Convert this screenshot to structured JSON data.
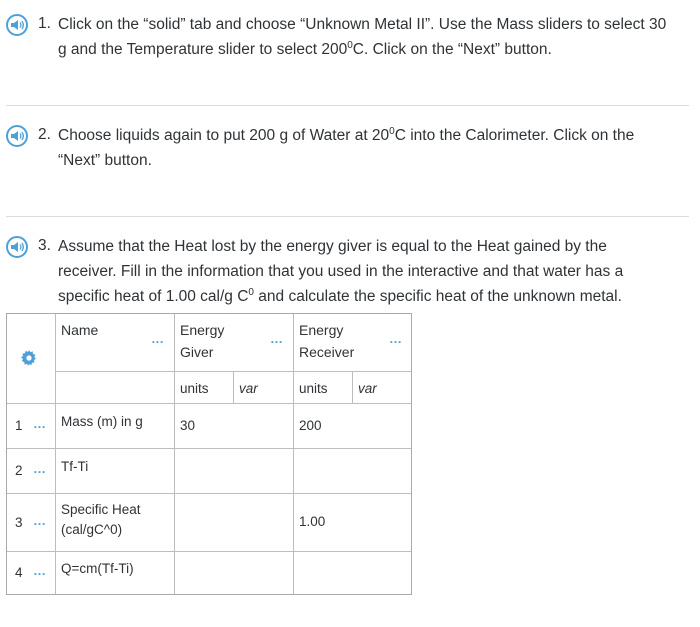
{
  "questions": [
    {
      "number": "1.",
      "lines": [
        "Click on the “solid” tab and choose “Unknown Metal II”.  Use the Mass sliders to select 30",
        [
          "g and the Temperature slider to select 200",
          "0",
          "C.  Click on the “Next” button."
        ]
      ]
    },
    {
      "number": "2.",
      "lines": [
        [
          "Choose liquids again to put 200 g of Water at 20",
          "0",
          "C into the Calorimeter. Click on the"
        ],
        "“Next” button."
      ]
    },
    {
      "number": "3.",
      "lines": [
        "Assume that the Heat lost by the energy giver is equal to the Heat gained by the",
        "receiver. Fill in the information that you used in the interactive and that water has a",
        [
          "specific heat of 1.00 cal/g C",
          "0",
          " and calculate the specific heat of the unknown metal."
        ]
      ]
    }
  ],
  "table": {
    "headers": {
      "name": "Name",
      "giver": [
        "Energy",
        "Giver"
      ],
      "receiver": [
        "Energy",
        "Receiver"
      ]
    },
    "subheaders": {
      "giver_units": "units",
      "giver_var": "var",
      "receiver_units": "units",
      "receiver_var": "var"
    },
    "rows": [
      {
        "num": "1",
        "name": [
          "Mass (m) in g"
        ],
        "giver": "30",
        "receiver": "200"
      },
      {
        "num": "2",
        "name": [
          "Tf-Ti"
        ],
        "giver": "",
        "receiver": ""
      },
      {
        "num": "3",
        "name": [
          "Specific Heat",
          "(cal/gC^0)"
        ],
        "giver": "",
        "receiver": "1.00"
      },
      {
        "num": "4",
        "name": [
          "Q=cm(Tf-Ti)"
        ],
        "giver": "",
        "receiver": ""
      }
    ],
    "ellipsis": "…"
  },
  "colors": {
    "accent": "#4ea0d8",
    "divider": "#dcdcdc"
  },
  "icons": {
    "speaker": "speaker-icon",
    "settings": "gear-icon",
    "more": "ellipsis-icon"
  }
}
